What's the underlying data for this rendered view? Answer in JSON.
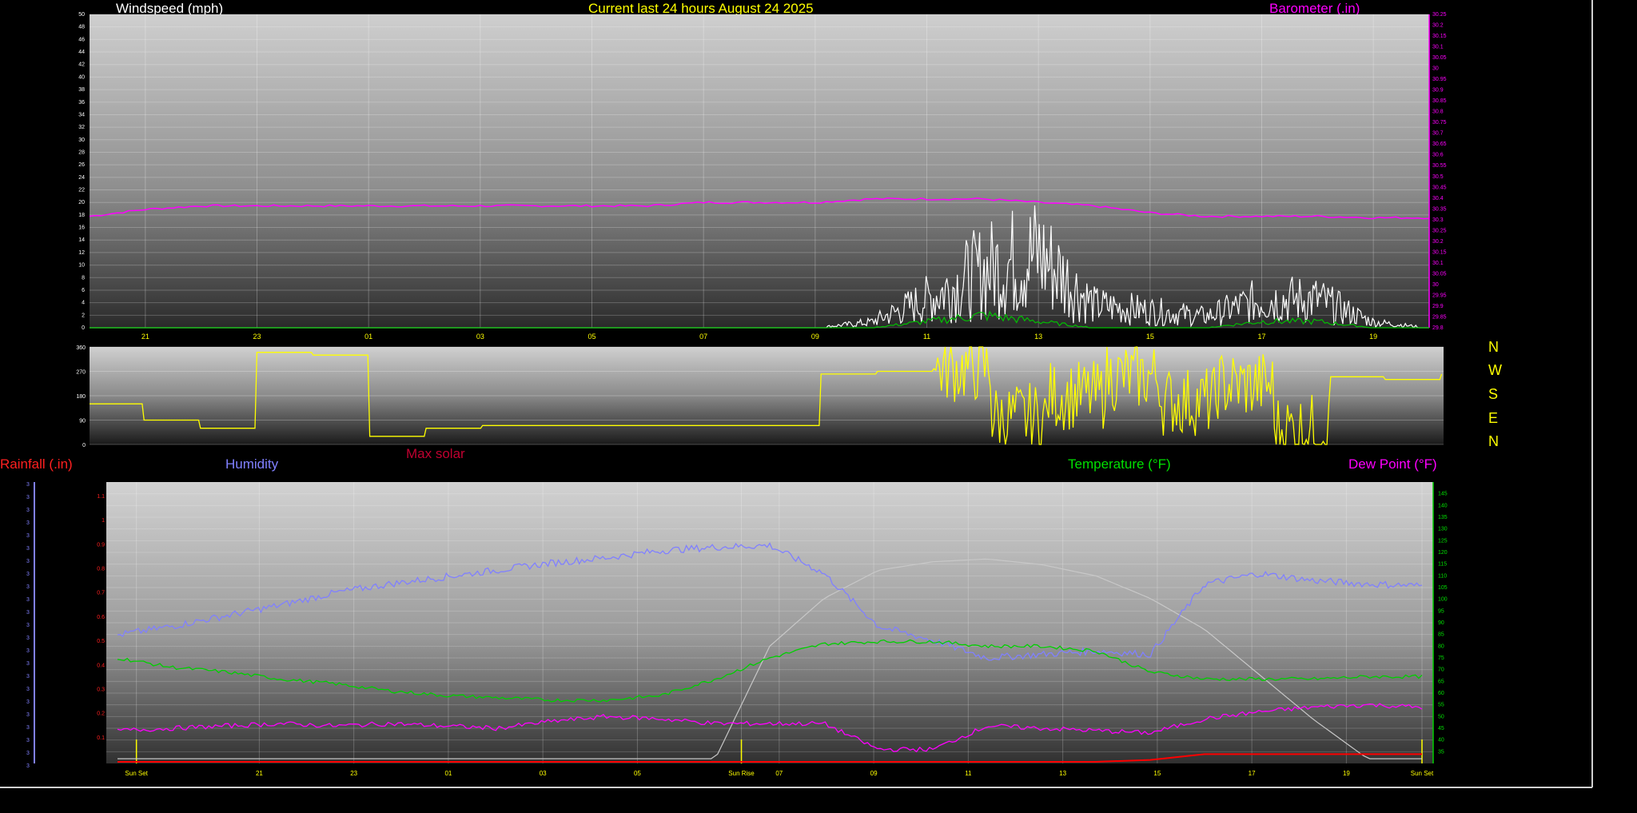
{
  "colors": {
    "windspeed": "#ffffff",
    "gust": "#00c000",
    "barometer": "#ff00ff",
    "direction": "#ffff00",
    "humidity": "#8080ff",
    "temperature": "#00d000",
    "dewpoint": "#ff00ff",
    "rainfall": "#ff0000",
    "solar": "#c8c8c8",
    "title": "#ffff00",
    "maxsolar": "#c00030"
  },
  "compass": [
    "N",
    "W",
    "S",
    "E",
    "N"
  ],
  "chart_data": [
    {
      "type": "line",
      "name": "top",
      "title": "Current last 24 hours August 24 2025",
      "ylabel_left": "Windspeed (mph)",
      "ylabel_right": "Barometer (.in)",
      "ylim": [
        0,
        50
      ],
      "ylim_right": [
        29.8,
        30.25
      ],
      "yticks": [
        0,
        2,
        4,
        6,
        8,
        10,
        12,
        14,
        16,
        18,
        20,
        22,
        24,
        26,
        28,
        30,
        32,
        34,
        36,
        38,
        40,
        42,
        44,
        46,
        48,
        50
      ],
      "yticks_right": [
        "29.8",
        "29.85",
        "29.9",
        "29.95",
        "30",
        "30.05",
        "30.1",
        "30.15",
        "30.2",
        "30.25",
        "30.3",
        "30.35",
        "30.4",
        "30.45",
        "30.5",
        "30.55",
        "30.6",
        "30.65",
        "30.7",
        "30.75",
        "30.8",
        "30.85",
        "30.9",
        "30.95",
        "30",
        "30.05",
        "30.1",
        "30.15",
        "30.2",
        "30.25"
      ],
      "xticks": [
        "21",
        "23",
        "01",
        "03",
        "05",
        "07",
        "09",
        "11",
        "13",
        "15",
        "17",
        "19"
      ],
      "x": [
        0,
        1,
        2,
        3,
        4,
        5,
        6,
        7,
        8,
        9,
        10,
        11,
        12,
        13,
        14,
        15,
        16,
        17,
        18,
        19,
        20,
        21,
        22,
        23,
        24
      ],
      "series": [
        {
          "name": "Barometer (.in)",
          "axis": "right",
          "values": [
            29.96,
            29.97,
            29.975,
            29.975,
            29.975,
            29.975,
            29.975,
            29.975,
            29.975,
            29.975,
            29.975,
            29.98,
            29.98,
            29.98,
            29.985,
            29.985,
            29.985,
            29.98,
            29.975,
            29.965,
            29.96,
            29.96,
            29.96,
            29.958,
            29.958
          ]
        },
        {
          "name": "windspeed",
          "axis": "left",
          "values": [
            0,
            0,
            0,
            0,
            0,
            0,
            0,
            0,
            0,
            0,
            0,
            0,
            0,
            0,
            1,
            5,
            10,
            13,
            4,
            3,
            2,
            5,
            5,
            1,
            0
          ]
        },
        {
          "name": "gust",
          "axis": "left",
          "values": [
            0,
            0,
            0,
            0,
            0,
            0,
            0,
            0,
            0,
            0,
            0,
            0,
            0,
            0,
            0,
            1,
            2,
            1,
            0,
            0,
            0,
            1,
            1,
            0,
            0
          ]
        }
      ]
    },
    {
      "type": "line",
      "name": "wind-direction",
      "ylim": [
        0,
        360
      ],
      "yticks": [
        0,
        90,
        180,
        270,
        360
      ],
      "x": [
        0,
        1,
        2,
        3,
        4,
        5,
        6,
        7,
        8,
        9,
        10,
        11,
        12,
        13,
        14,
        15,
        16,
        17,
        18,
        19,
        20,
        21,
        22,
        23,
        24
      ],
      "series": [
        {
          "name": "direction",
          "values": [
            150,
            90,
            60,
            340,
            330,
            30,
            60,
            70,
            70,
            70,
            70,
            70,
            70,
            260,
            270,
            280,
            100,
            180,
            250,
            160,
            220,
            60,
            250,
            240,
            260
          ]
        }
      ]
    },
    {
      "type": "line",
      "name": "bottom",
      "ylabels": [
        "Rainfall (.in)",
        "Humidity",
        "Max solar",
        "Temperature (°F)",
        "Dew Point (°F)"
      ],
      "ylim": [
        30,
        150
      ],
      "yticks_right": [
        35,
        40,
        45,
        50,
        55,
        60,
        65,
        70,
        75,
        80,
        85,
        90,
        95,
        100,
        105,
        110,
        115,
        120,
        125,
        130,
        135,
        140,
        145
      ],
      "yticks_red": [
        "0.1",
        "0.2",
        "0.3",
        "0.4",
        "0.5",
        "0.6",
        "0.7",
        "0.8",
        "0.9",
        "1",
        "1.1"
      ],
      "rain_axis_labels": [
        "3",
        "3",
        "3",
        "3",
        "3",
        "3",
        "3",
        "3",
        "3",
        "3",
        "3",
        "3",
        "3",
        "3",
        "3",
        "3",
        "3",
        "3",
        "3",
        "3",
        "3",
        "3",
        "3"
      ],
      "xticks": [
        "Sun Set",
        "21",
        "23",
        "01",
        "03",
        "05",
        "Sun Rise",
        "07",
        "09",
        "11",
        "13",
        "15",
        "17",
        "19",
        "Sun Set"
      ],
      "x": [
        0,
        1,
        2,
        3,
        4,
        5,
        6,
        7,
        8,
        9,
        10,
        11,
        12,
        13,
        14,
        15,
        16,
        17,
        18,
        19,
        20,
        21,
        22,
        23,
        24
      ],
      "series": [
        {
          "name": "Humidity",
          "values": [
            73,
            78,
            84,
            90,
            97,
            102,
            106,
            110,
            114,
            117,
            121,
            123,
            124,
            108,
            78,
            70,
            60,
            62,
            64,
            62,
            102,
            108,
            104,
            102,
            101
          ]
        },
        {
          "name": "Temperature (°F)",
          "values": [
            75,
            71,
            69,
            66,
            64,
            61,
            59,
            58,
            57,
            57,
            59,
            66,
            75,
            81,
            82,
            82,
            80,
            80,
            78,
            69,
            66,
            66,
            66,
            67,
            67
          ]
        },
        {
          "name": "Dew Point (°F)",
          "values": [
            44,
            45,
            46,
            47,
            46,
            47,
            46,
            45,
            48,
            50,
            49,
            47,
            47,
            47,
            36,
            36,
            46,
            45,
            44,
            43,
            49,
            52,
            54,
            55,
            54
          ]
        },
        {
          "name": "Rainfall (.in)",
          "values": [
            0,
            0,
            0,
            0,
            0,
            0,
            0,
            0,
            0,
            0,
            0,
            0,
            0,
            0,
            0,
            0,
            0,
            0,
            0,
            0.02,
            0.08,
            0.08,
            0.08,
            0.08,
            0.08
          ]
        },
        {
          "name": "Max solar",
          "values": [
            0,
            0,
            0,
            0,
            0,
            0,
            0,
            0,
            0,
            0,
            0,
            0,
            40,
            57,
            67,
            70,
            71,
            69,
            65,
            57,
            46,
            30,
            14,
            0,
            0
          ]
        }
      ]
    }
  ]
}
